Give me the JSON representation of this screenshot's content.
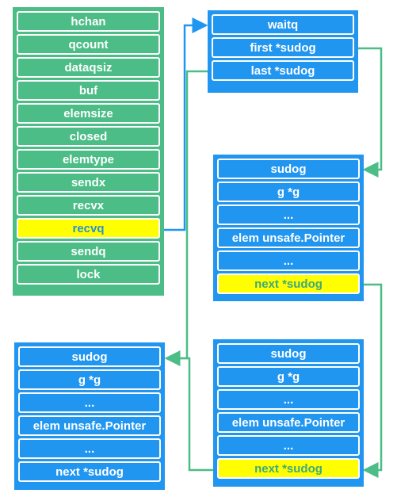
{
  "colors": {
    "green": "#4cbd86",
    "blue": "#2196f0",
    "highlight": "#ffff00"
  },
  "hchan": {
    "rows": [
      "hchan",
      "qcount",
      "dataqsiz",
      "buf",
      "elemsize",
      "closed",
      "elemtype",
      "sendx",
      "recvx",
      "recvq",
      "sendq",
      "lock"
    ],
    "highlighted": "recvq"
  },
  "waitq": {
    "rows": [
      "waitq",
      "first *sudog",
      "last *sudog"
    ]
  },
  "sudog_middle": {
    "rows": [
      "sudog",
      "g *g",
      "...",
      "elem unsafe.Pointer",
      "...",
      "next *sudog"
    ],
    "highlighted": "next *sudog"
  },
  "sudog_bottom_right": {
    "rows": [
      "sudog",
      "g *g",
      "...",
      "elem unsafe.Pointer",
      "...",
      "next *sudog"
    ],
    "highlighted": "next *sudog"
  },
  "sudog_bottom_left": {
    "rows": [
      "sudog",
      "g *g",
      "...",
      "elem unsafe.Pointer",
      "...",
      "next *sudog"
    ]
  }
}
